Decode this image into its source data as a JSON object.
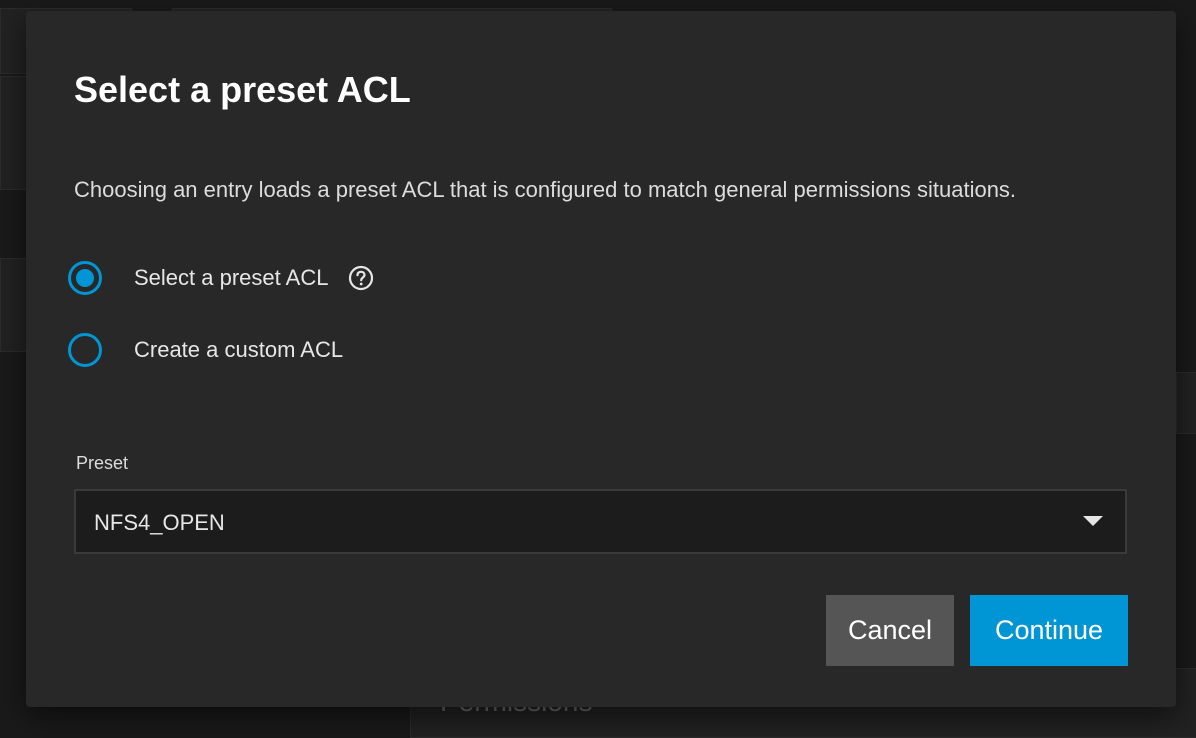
{
  "background": {
    "section_title": "Permissions"
  },
  "dialog": {
    "title": "Select a preset ACL",
    "description": "Choosing an entry loads a preset ACL that is configured to match general permissions situations.",
    "options": [
      {
        "label": "Select a preset ACL",
        "selected": true,
        "has_help_icon": true
      },
      {
        "label": "Create a custom ACL",
        "selected": false
      }
    ],
    "preset": {
      "label": "Preset",
      "value": "NFS4_OPEN"
    },
    "buttons": {
      "cancel": "Cancel",
      "continue": "Continue"
    }
  },
  "colors": {
    "accent": "#0095d5",
    "dialog_bg": "#282828",
    "cancel_bg": "#555555"
  }
}
